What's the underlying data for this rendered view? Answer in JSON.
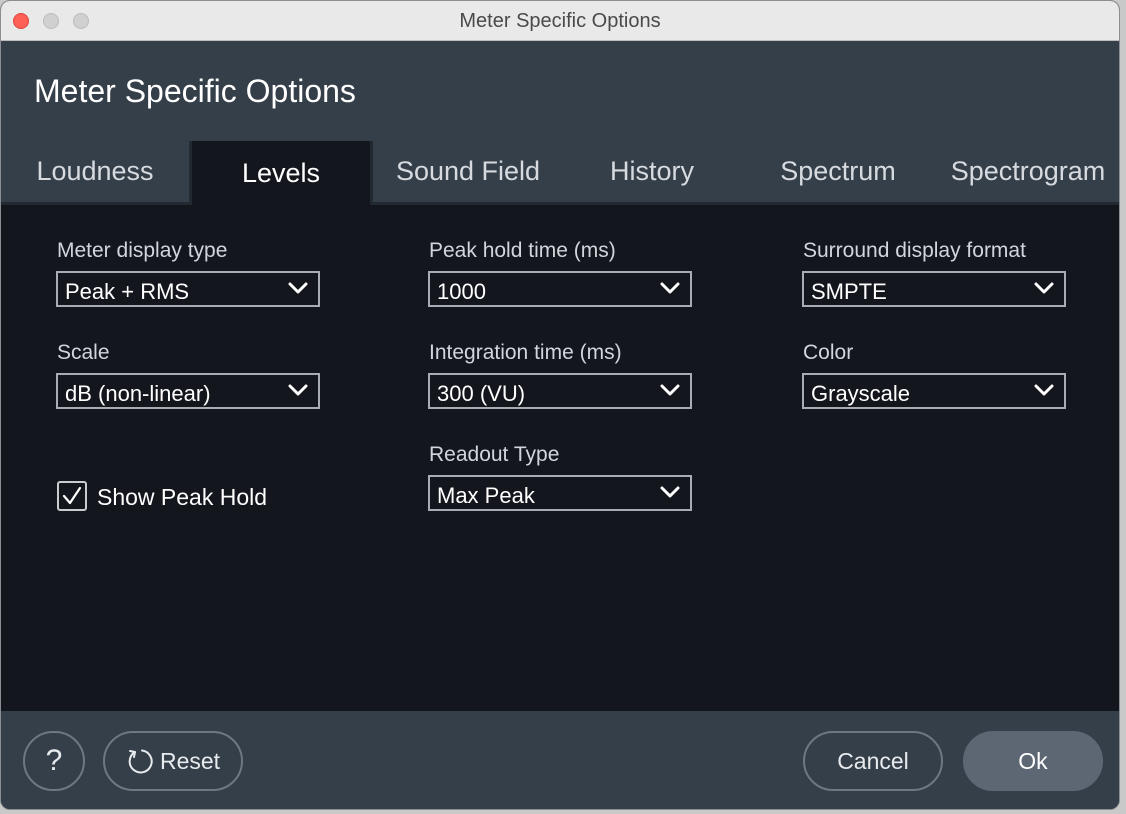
{
  "window": {
    "title": "Meter Specific Options"
  },
  "header": {
    "title": "Meter Specific Options"
  },
  "tabs": [
    {
      "label": "Loudness",
      "active": false
    },
    {
      "label": "Levels",
      "active": true
    },
    {
      "label": "Sound Field",
      "active": false
    },
    {
      "label": "History",
      "active": false
    },
    {
      "label": "Spectrum",
      "active": false
    },
    {
      "label": "Spectrogram",
      "active": false
    }
  ],
  "fields": {
    "meter_display_type": {
      "label": "Meter display type",
      "value": "Peak + RMS"
    },
    "scale": {
      "label": "Scale",
      "value": "dB (non-linear)"
    },
    "peak_hold_time": {
      "label": "Peak hold time (ms)",
      "value": "1000"
    },
    "integration_time": {
      "label": "Integration time (ms)",
      "value": "300 (VU)"
    },
    "readout_type": {
      "label": "Readout Type",
      "value": "Max Peak"
    },
    "surround_display_format": {
      "label": "Surround display format",
      "value": "SMPTE"
    },
    "color": {
      "label": "Color",
      "value": "Grayscale"
    }
  },
  "show_peak_hold": {
    "label": "Show Peak Hold",
    "checked": true
  },
  "footer": {
    "help_label": "?",
    "reset_label": "Reset",
    "cancel_label": "Cancel",
    "ok_label": "Ok"
  },
  "icons": {
    "chevron": "chevron-down-icon",
    "check": "checkmark-icon",
    "reset": "reset-icon"
  }
}
